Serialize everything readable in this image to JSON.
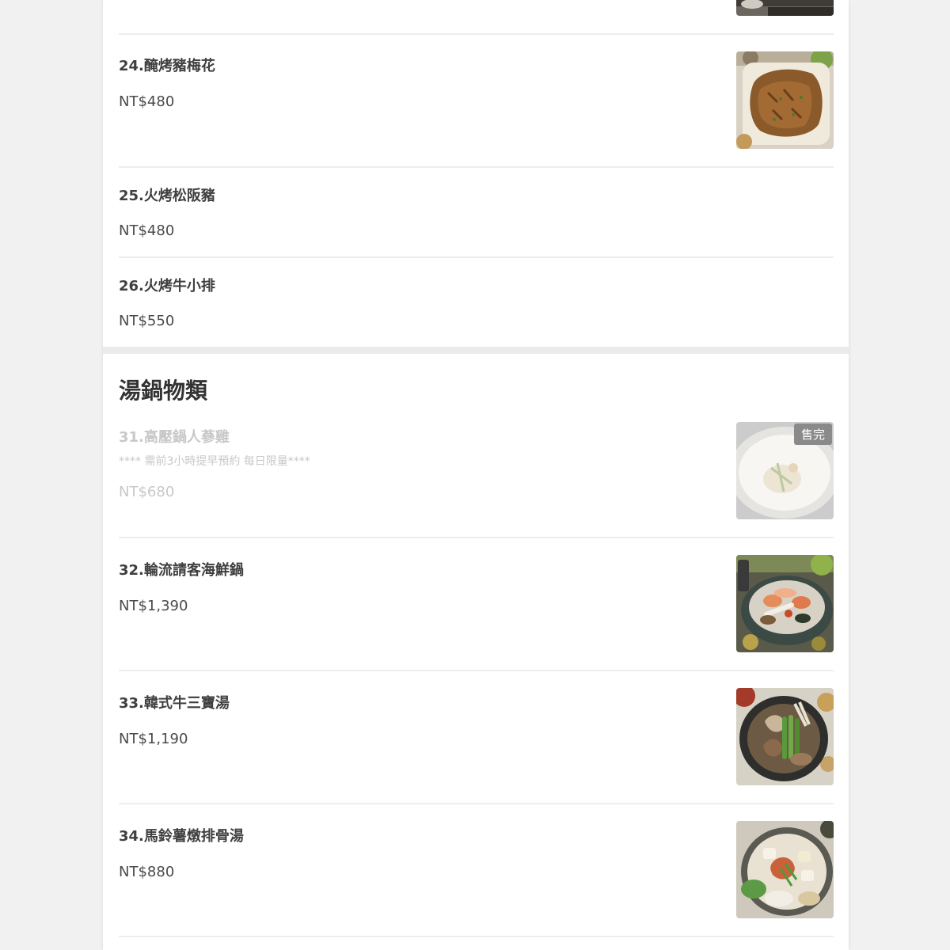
{
  "section_title": "湯鍋物類",
  "items": [
    {
      "name": "24.醃烤豬梅花",
      "price": "NT$480"
    },
    {
      "name": "25.火烤松阪豬",
      "price": "NT$480"
    },
    {
      "name": "26.火烤牛小排",
      "price": "NT$550"
    },
    {
      "name": "31.高壓鍋人蔘雞",
      "desc": "**** 需前3小時提早預約 每日限量****",
      "price": "NT$680",
      "badge": "售完"
    },
    {
      "name": "32.輪流請客海鮮鍋",
      "price": "NT$1,390"
    },
    {
      "name": "33.韓式牛三寶湯",
      "price": "NT$1,190"
    },
    {
      "name": "34.馬鈴薯燉排骨湯",
      "price": "NT$880"
    }
  ],
  "icons": {
    "dish_images": [
      "grilled-pork-photo",
      "ginseng-chicken-photo",
      "seafood-pot-photo",
      "beef-soup-photo",
      "pork-rib-soup-photo"
    ]
  },
  "colors": {
    "page_background": "#f1f1f1",
    "card_background": "#ffffff",
    "sold_out_badge": "#8a8a8a",
    "sold_out_text": "#c8c8c8"
  }
}
